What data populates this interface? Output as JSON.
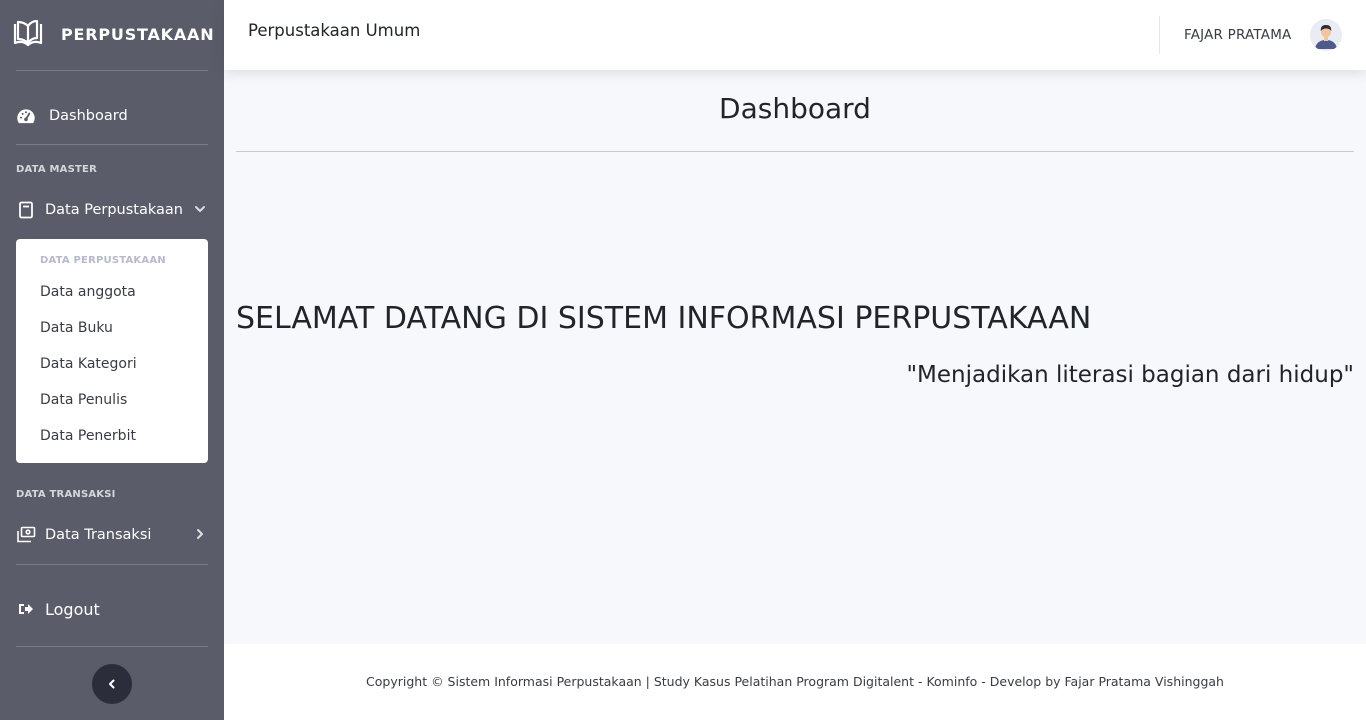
{
  "sidebar": {
    "brand": "PERPUSTAKAAN",
    "dashboard_label": "Dashboard",
    "section_master": "DATA MASTER",
    "data_perpustakaan_label": "Data Perpustakaan",
    "submenu": {
      "heading": "DATA PERPUSTAKAAN",
      "items": [
        {
          "label": "Data anggota"
        },
        {
          "label": "Data Buku"
        },
        {
          "label": "Data Kategori"
        },
        {
          "label": "Data Penulis"
        },
        {
          "label": "Data Penerbit"
        }
      ]
    },
    "section_transaksi": "DATA TRANSAKSI",
    "data_transaksi_label": "Data Transaksi",
    "logout_label": "Logout"
  },
  "topbar": {
    "title": "Perpustakaan Umum",
    "user_name": "FAJAR PRATAMA"
  },
  "main": {
    "page_title": "Dashboard",
    "welcome": "SELAMAT DATANG DI SISTEM INFORMASI PERPUSTAKAAN",
    "quote": "\"Menjadikan literasi bagian dari hidup\""
  },
  "footer": {
    "text": "Copyright © Sistem Informasi Perpustakaan | Study Kasus Pelatihan Program Digitalent - Kominfo - Develop by Fajar Pratama Vishinggah"
  },
  "colors": {
    "sidebar_bg": "#5a5c69",
    "page_bg": "#f7f8fc",
    "toggle_bg": "#2b2d3a"
  }
}
